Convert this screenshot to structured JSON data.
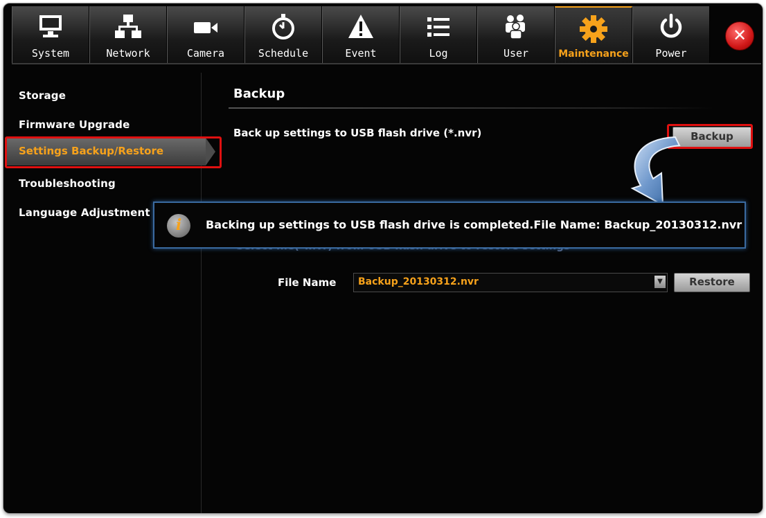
{
  "tabs": [
    {
      "label": "System",
      "icon": "monitor-icon"
    },
    {
      "label": "Network",
      "icon": "network-icon"
    },
    {
      "label": "Camera",
      "icon": "camera-icon"
    },
    {
      "label": "Schedule",
      "icon": "clock-icon"
    },
    {
      "label": "Event",
      "icon": "warning-icon"
    },
    {
      "label": "Log",
      "icon": "list-icon"
    },
    {
      "label": "User",
      "icon": "users-icon"
    },
    {
      "label": "Maintenance",
      "icon": "gear-icon",
      "active": true
    },
    {
      "label": "Power",
      "icon": "power-icon"
    }
  ],
  "sidebar": {
    "items": [
      {
        "label": "Storage"
      },
      {
        "label": "Firmware Upgrade"
      },
      {
        "label": "Settings Backup/Restore",
        "active": true
      },
      {
        "label": "Troubleshooting"
      },
      {
        "label": "Language Adjustment"
      }
    ]
  },
  "main": {
    "section_title": "Backup",
    "backup_description": "Back up settings to USB flash drive (*.nvr)",
    "backup_button": "Backup",
    "restore_description": "Select file(*.nvr) from USB flash drive to restore settings",
    "file_name_label": "File Name",
    "file_name_value": "Backup_20130312.nvr",
    "restore_button": "Restore"
  },
  "popup": {
    "message": "Backing up settings to USB flash drive is completed.File Name: Backup_20130312.nvr",
    "icon": "info-icon"
  },
  "colors": {
    "accent": "#f7a21b",
    "highlight": "#e01010",
    "popup_border": "#3a6aa0"
  }
}
